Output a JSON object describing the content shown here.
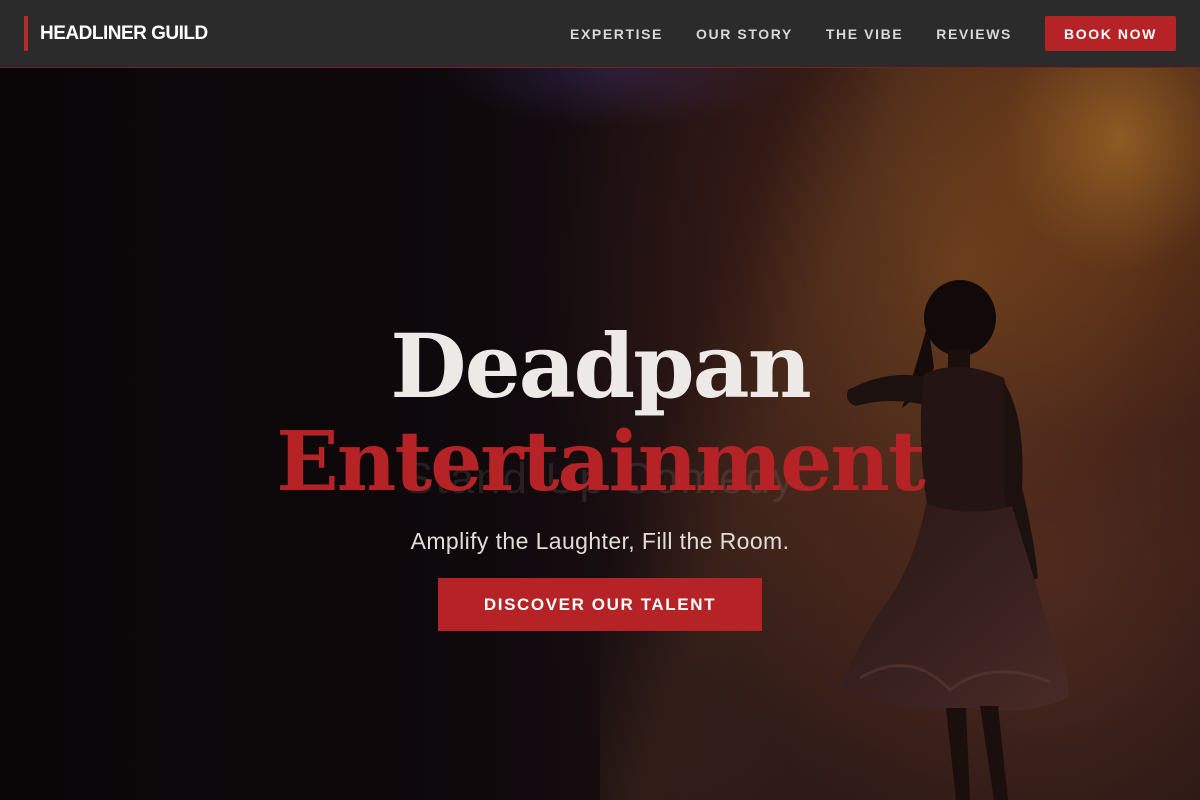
{
  "header": {
    "brand": "HEADLINER GUILD",
    "nav": [
      "EXPERTISE",
      "OUR STORY",
      "THE VIBE",
      "REVIEWS"
    ],
    "book_label": "BOOK NOW"
  },
  "hero": {
    "title_line1": "Deadpan",
    "title_line2": "Entertainment",
    "ghost_text": "Stand-Up Comedy",
    "subtitle": "Amplify the Laughter, Fill the Room.",
    "cta_label": "DISCOVER OUR TALENT"
  },
  "colors": {
    "accent": "#b52326",
    "header_bg": "#2b2b2b",
    "title_light": "#ece9e6"
  }
}
